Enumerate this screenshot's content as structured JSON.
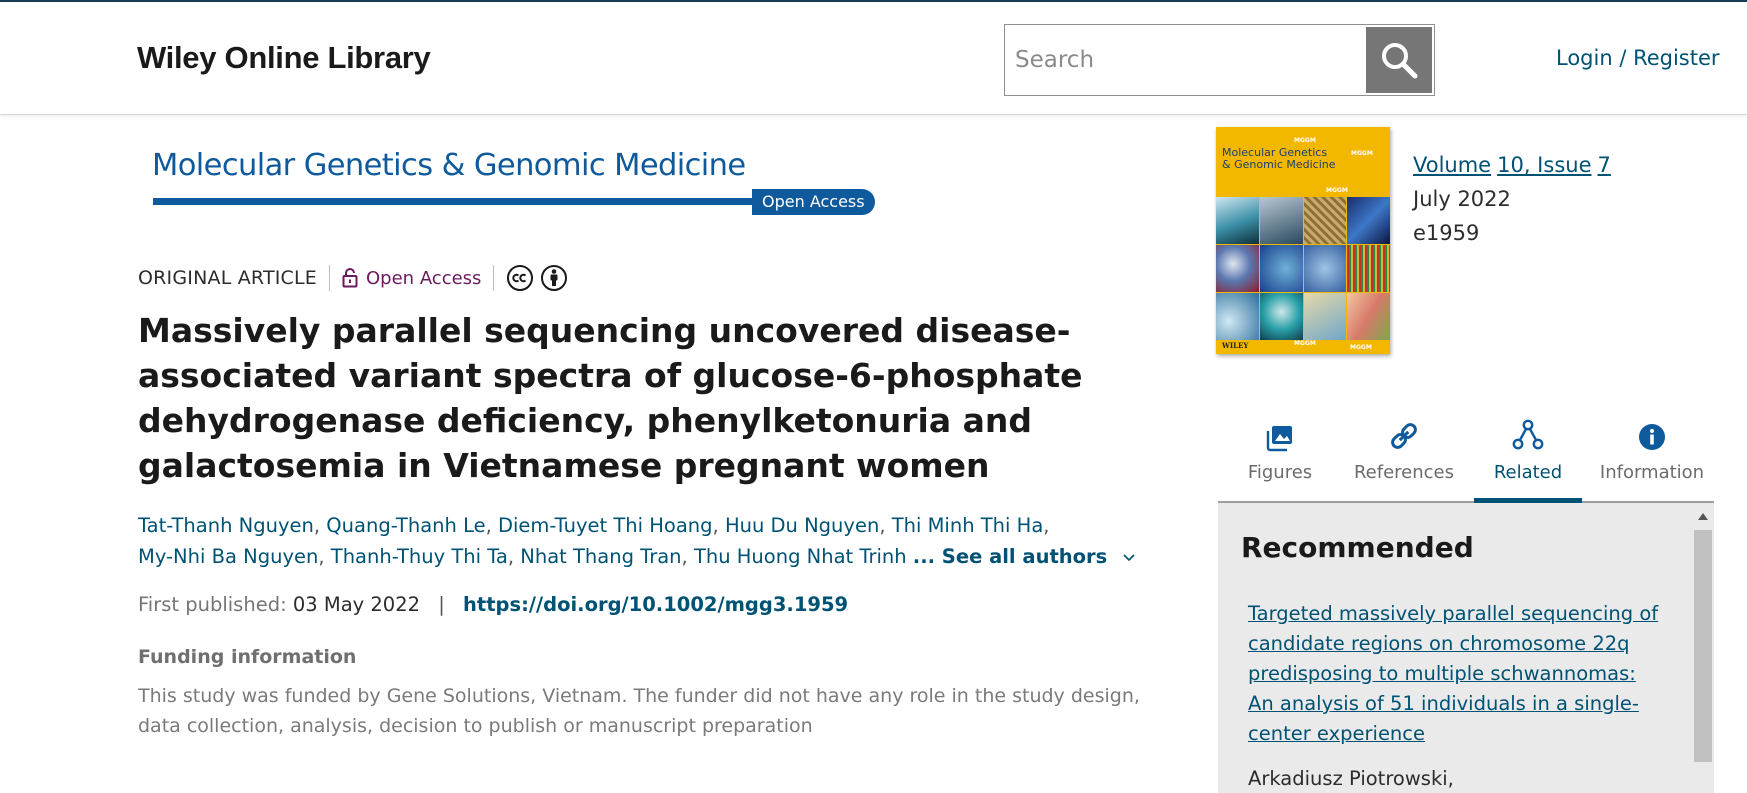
{
  "header": {
    "brand": "Wiley Online Library",
    "search_placeholder": "Search",
    "login": "Login / Register"
  },
  "journal": {
    "name": "Molecular Genetics & Genomic Medicine",
    "open_access_pill": "Open Access"
  },
  "article": {
    "type": "ORIGINAL ARTICLE",
    "open_access": "Open Access",
    "license_icons": [
      "creative-commons-icon",
      "attribution-icon"
    ],
    "title": "Massively parallel sequencing uncovered disease-associated variant spectra of glucose-6-phosphate dehydrogenase deficiency, phenylketonuria and galactosemia in Vietnamese pregnant women",
    "authors": [
      "Tat-Thanh Nguyen",
      "Quang-Thanh Le",
      "Diem-Tuyet Thi Hoang",
      "Huu Du Nguyen",
      "Thi Minh Thi Ha",
      "My-Nhi Ba Nguyen",
      "Thanh-Thuy Thi Ta",
      "Nhat Thang Tran",
      "Thu Huong Nhat Trinh"
    ],
    "see_all_authors": "... See all authors",
    "first_published_label": "First published:",
    "first_published_date": "03 May 2022",
    "separator": "|",
    "doi": "https://doi.org/10.1002/mgg3.1959",
    "funding_heading": "Funding information",
    "funding_text": "This study was funded by Gene Solutions, Vietnam. The funder did not have any role in the study design, data collection, analysis, decision to publish or manuscript preparation"
  },
  "cover": {
    "title_line1": "Molecular Genetics",
    "title_line2": "& Genomic Medicine",
    "tag": "MGGM",
    "publisher": "WILEY"
  },
  "issue": {
    "volume": "Volume",
    "issue_label": "10, Issue",
    "issue_number": "7",
    "date": "July 2022",
    "article_number": "e1959"
  },
  "tabs": [
    {
      "label": "Figures",
      "icon": "image-icon",
      "active": false
    },
    {
      "label": "References",
      "icon": "link-icon",
      "active": false
    },
    {
      "label": "Related",
      "icon": "related-nodes-icon",
      "active": true
    },
    {
      "label": "Information",
      "icon": "info-icon",
      "active": false
    }
  ],
  "recommended": {
    "heading": "Recommended",
    "items": [
      {
        "title": "Targeted massively parallel sequencing of candidate regions on chromosome 22q predisposing to multiple schwannomas: An analysis of 51 individuals in a single-center experience",
        "authors": "Arkadiusz Piotrowski,"
      }
    ]
  },
  "colors": {
    "link": "#005274",
    "journal_blue": "#0e5a9c",
    "open_access_purple": "#6a1b5e",
    "search_button": "#767676",
    "panel_bg": "#eaeaea"
  }
}
